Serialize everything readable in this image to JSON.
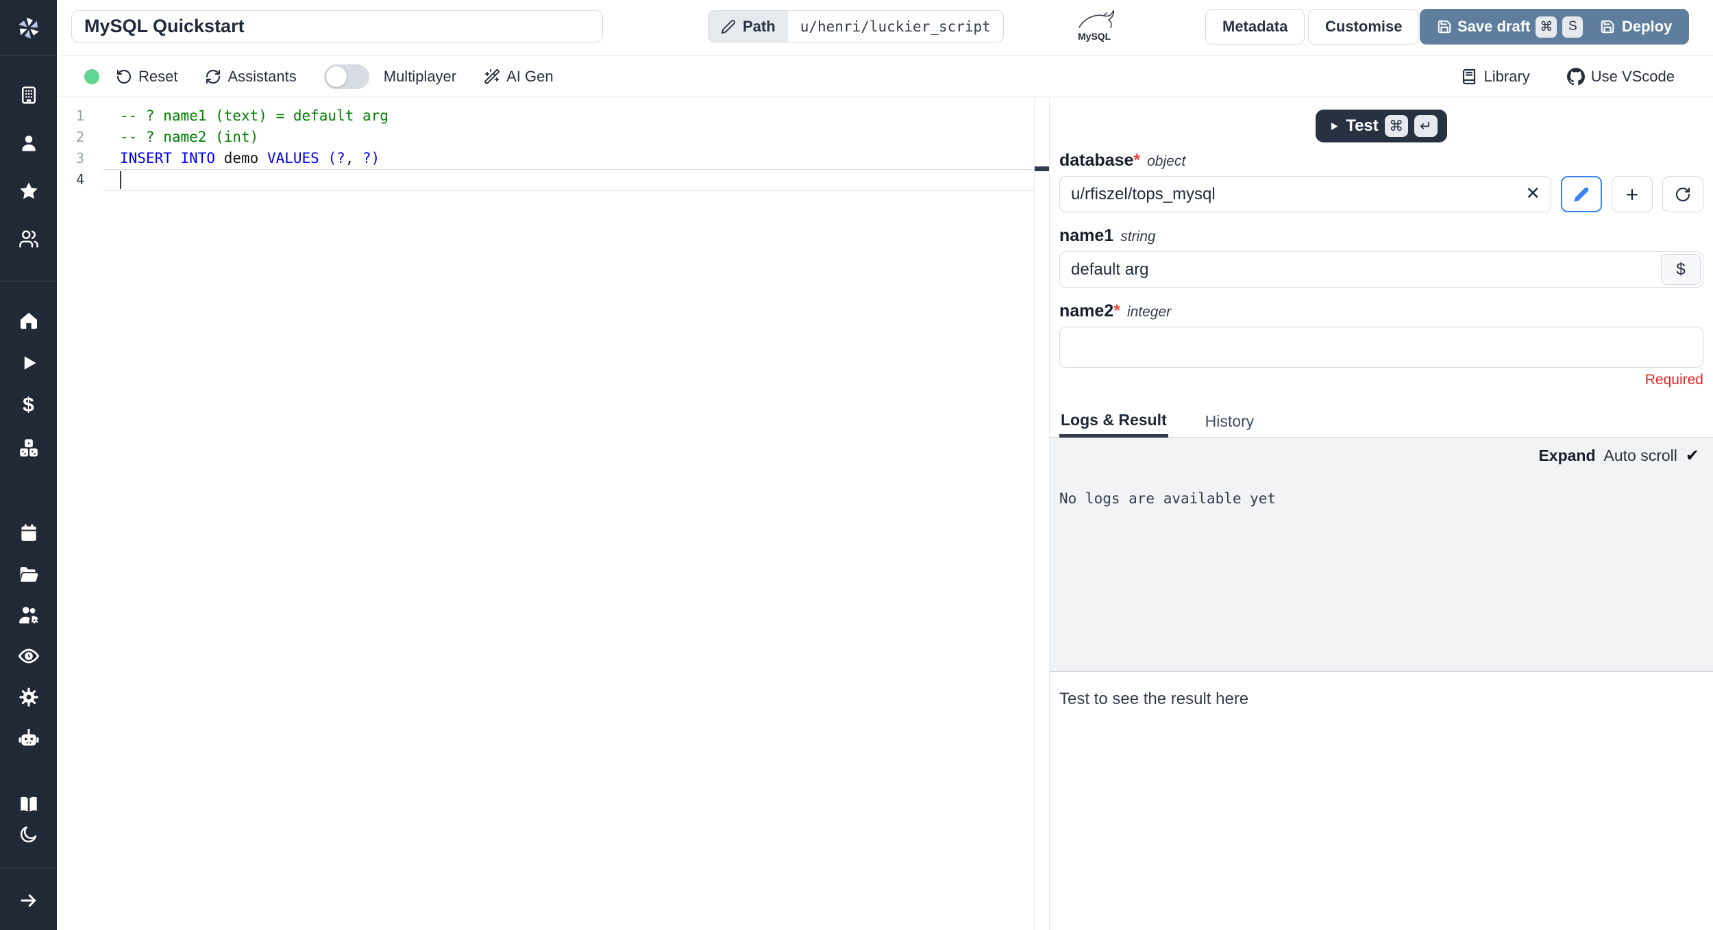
{
  "topbar": {
    "title": "MySQL Quickstart",
    "path_label": "Path",
    "path_value": "u/henri/luckier_script",
    "mysql_badge": "MySQL",
    "metadata_label": "Metadata",
    "customise_label": "Customise",
    "save_draft_label": "Save draft",
    "save_draft_kbd_1": "⌘",
    "save_draft_kbd_2": "S",
    "deploy_label": "Deploy"
  },
  "toolbar": {
    "reset_label": "Reset",
    "assistants_label": "Assistants",
    "multiplayer_label": "Multiplayer",
    "ai_gen_label": "AI Gen",
    "library_label": "Library",
    "vscode_label": "Use VScode"
  },
  "editor": {
    "language": "sql",
    "line_numbers": [
      "1",
      "2",
      "3",
      "4"
    ],
    "line1_comment": "-- ? name1 (text) = default arg",
    "line2_comment": "-- ? name2 (int)",
    "line3_t1": "INSERT INTO",
    "line3_t2": " demo ",
    "line3_t3": "VALUES",
    "line3_t4": " (?",
    "line3_t5": ",",
    "line3_t6": " ?)"
  },
  "run_panel": {
    "test_label": "Test",
    "test_kbd_1": "⌘",
    "test_kbd_2": "↵",
    "fields": [
      {
        "label": "database",
        "req": "*",
        "type": "object",
        "value": "u/rfiszel/tops_mysql"
      },
      {
        "label": "name1",
        "type": "string",
        "value": "default arg",
        "suffix": "$"
      },
      {
        "label": "name2",
        "req": "*",
        "type": "integer",
        "value": "",
        "error": "Required"
      }
    ],
    "tabs": {
      "active": "Logs & Result",
      "inactive": "History"
    },
    "logs": {
      "expand_label": "Expand",
      "autoscroll_label": "Auto scroll",
      "check": "✔",
      "empty_message": "No logs are available yet"
    },
    "result_placeholder": "Test to see the result here"
  },
  "icons": {
    "close": "✕",
    "plus": "+",
    "dollar": "$"
  },
  "sidebar_icon_names": [
    "windmill-logo",
    "building",
    "user",
    "star",
    "users",
    "home",
    "play",
    "dollar",
    "cubes",
    "calendar",
    "folder-open",
    "users-gear",
    "eye",
    "gear",
    "robot",
    "book-open",
    "moon",
    "arrow-right"
  ],
  "colors": {
    "sidebar_bg": "#222936",
    "accent_blue": "#3b82f6",
    "button_slate": "#5f7e9e",
    "dark_button": "#273142",
    "status_green": "#5fd68f",
    "required_red": "#dc2626",
    "comment_green": "#008000",
    "keyword_blue": "#0000f0",
    "logs_bg": "#f1f3f5"
  }
}
